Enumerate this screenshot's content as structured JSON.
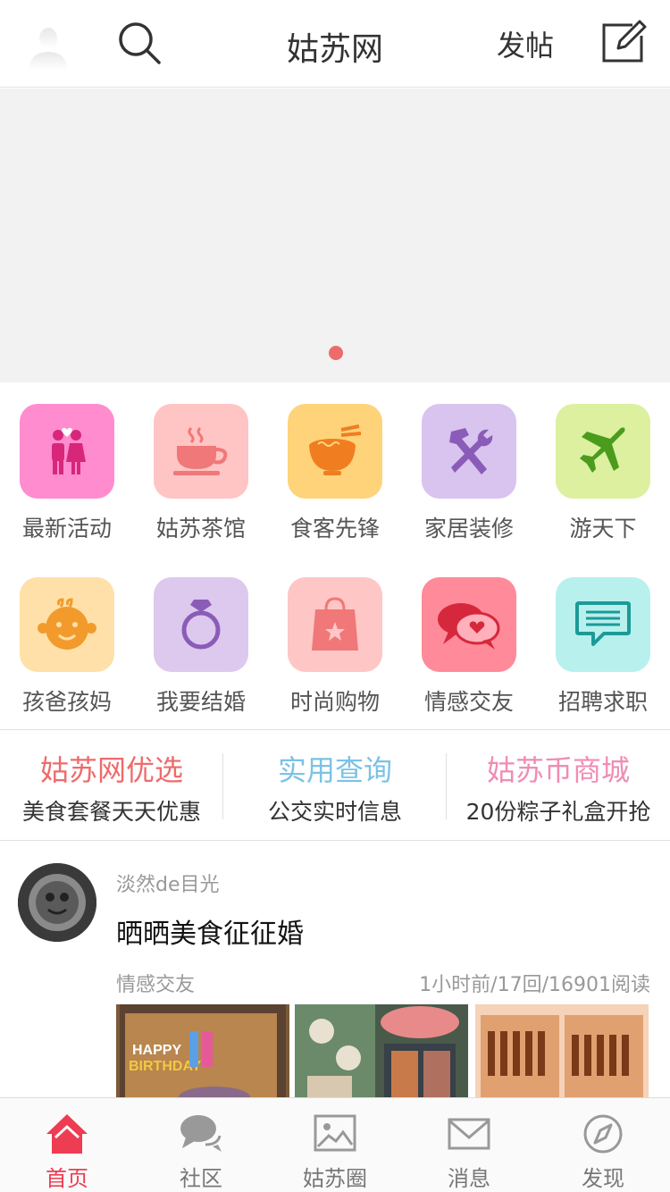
{
  "header": {
    "title": "姑苏网",
    "post_label": "发帖",
    "icons": [
      "avatar-placeholder",
      "search-icon",
      "edit-icon"
    ]
  },
  "banner": {
    "dots": 1,
    "active_dot_color": "#ee6b6b"
  },
  "categories": [
    {
      "label": "最新活动",
      "icon": "couple-icon",
      "color": "#ff8ccf"
    },
    {
      "label": "姑苏茶馆",
      "icon": "teacup-icon",
      "color": "#ffc4c4"
    },
    {
      "label": "食客先锋",
      "icon": "noodle-bowl-icon",
      "color": "#ffd37a"
    },
    {
      "label": "家居装修",
      "icon": "tools-icon",
      "color": "#d8c4ee"
    },
    {
      "label": "游天下",
      "icon": "airplane-icon",
      "color": "#dcf0a0"
    },
    {
      "label": "孩爸孩妈",
      "icon": "baby-face-icon",
      "color": "#ffe0a8"
    },
    {
      "label": "我要结婚",
      "icon": "ring-icon",
      "color": "#ddc8ee"
    },
    {
      "label": "时尚购物",
      "icon": "shopping-bag-icon",
      "color": "#ffc6c6"
    },
    {
      "label": "情感交友",
      "icon": "chat-heart-icon",
      "color": "#ff8a9a"
    },
    {
      "label": "招聘求职",
      "icon": "message-icon",
      "color": "#b8f0ee"
    }
  ],
  "features": [
    {
      "title": "姑苏网优选",
      "subtitle": "美食套餐天天优惠",
      "color": "#ee6b6b"
    },
    {
      "title": "实用查询",
      "subtitle": "公交实时信息",
      "color": "#7ac2e6"
    },
    {
      "title": "姑苏币商城",
      "subtitle": "20份粽子礼盒开抢",
      "color": "#f08cb4"
    }
  ],
  "post": {
    "author": "淡然de目光",
    "title": "晒晒美食征征婚",
    "category": "情感交友",
    "meta": "1小时前/17回/16901阅读",
    "images": [
      "birthday-cake-photo",
      "sushi-photo",
      "skewers-photo"
    ]
  },
  "tabbar": {
    "active_color": "#ee3c52",
    "items": [
      {
        "label": "首页",
        "icon": "home-icon",
        "active": true
      },
      {
        "label": "社区",
        "icon": "chat-bubbles-icon",
        "active": false
      },
      {
        "label": "姑苏圈",
        "icon": "picture-icon",
        "active": false
      },
      {
        "label": "消息",
        "icon": "envelope-icon",
        "active": false
      },
      {
        "label": "发现",
        "icon": "compass-icon",
        "active": false
      }
    ]
  }
}
